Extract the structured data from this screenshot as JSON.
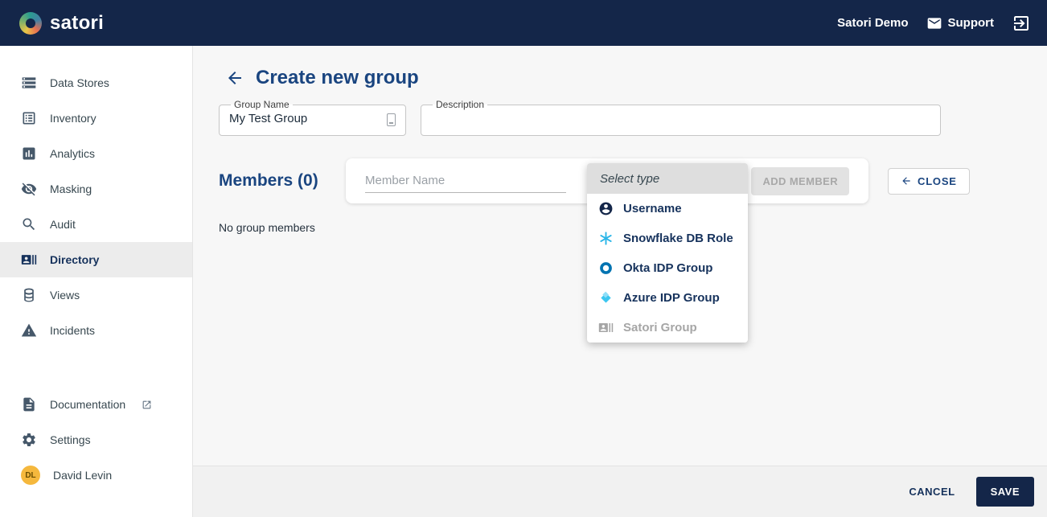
{
  "topbar": {
    "brand": "satori",
    "account_name": "Satori Demo",
    "support_label": "Support"
  },
  "sidebar": {
    "items": [
      {
        "label": "Data Stores",
        "icon": "data-stores-icon",
        "selected": false
      },
      {
        "label": "Inventory",
        "icon": "inventory-icon",
        "selected": false
      },
      {
        "label": "Analytics",
        "icon": "analytics-icon",
        "selected": false
      },
      {
        "label": "Masking",
        "icon": "masking-icon",
        "selected": false
      },
      {
        "label": "Audit",
        "icon": "audit-icon",
        "selected": false
      },
      {
        "label": "Directory",
        "icon": "directory-icon",
        "selected": true
      },
      {
        "label": "Views",
        "icon": "views-icon",
        "selected": false
      },
      {
        "label": "Incidents",
        "icon": "incidents-icon",
        "selected": false
      }
    ],
    "bottom_items": [
      {
        "label": "Documentation",
        "icon": "document-icon",
        "external": true
      },
      {
        "label": "Settings",
        "icon": "gear-icon",
        "external": false
      }
    ],
    "user": {
      "name": "David Levin",
      "initials": "DL"
    }
  },
  "main": {
    "page_title": "Create new group",
    "group_name_field": {
      "label": "Group Name",
      "value": "My Test Group"
    },
    "description_field": {
      "label": "Description",
      "value": ""
    },
    "members_section": {
      "heading": "Members (0)",
      "member_name_placeholder": "Member Name",
      "add_member_label": "ADD MEMBER",
      "close_label": "CLOSE",
      "empty_message": "No group members"
    },
    "type_dropdown": {
      "header": "Select type",
      "options": [
        {
          "label": "Username",
          "icon": "user-icon",
          "enabled": true
        },
        {
          "label": "Snowflake DB Role",
          "icon": "snowflake-icon",
          "enabled": true
        },
        {
          "label": "Okta IDP Group",
          "icon": "okta-icon",
          "enabled": true
        },
        {
          "label": "Azure IDP Group",
          "icon": "azure-icon",
          "enabled": true
        },
        {
          "label": "Satori Group",
          "icon": "satori-group-icon",
          "enabled": false
        }
      ]
    }
  },
  "footer": {
    "cancel_label": "CANCEL",
    "save_label": "SAVE"
  },
  "colors": {
    "topbar_navy": "#142649",
    "title_blue": "#1a4580",
    "snowflake_blue": "#29b5e8",
    "okta_blue": "#0073b1",
    "azure_blue": "#3cc6f0",
    "avatar_yellow": "#f5b83d"
  }
}
